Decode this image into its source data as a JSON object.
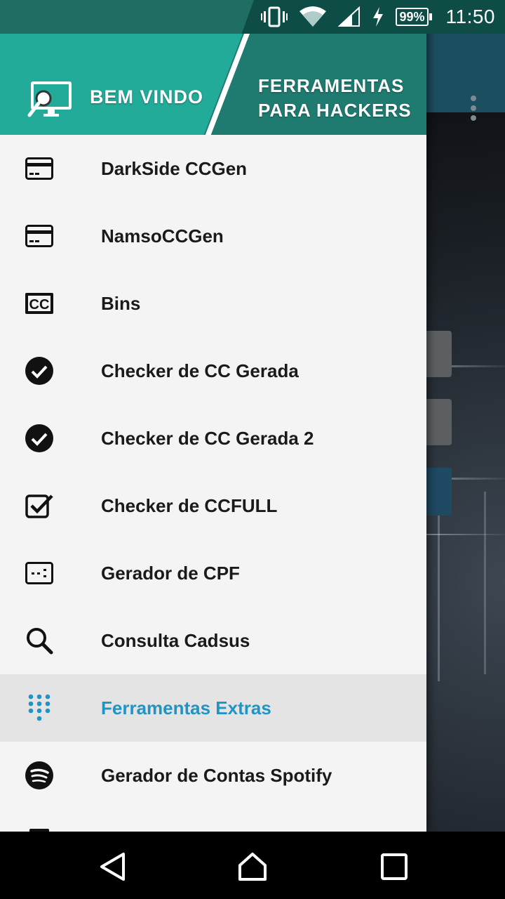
{
  "status_bar": {
    "battery": "99%",
    "time": "11:50",
    "icons": [
      "vibrate-icon",
      "wifi-icon",
      "signal-icon",
      "charging-icon",
      "battery-icon"
    ]
  },
  "drawer": {
    "header": {
      "welcome": "BEM VINDO",
      "brand_line1": "FERRAMENTAS",
      "brand_line2": "PARA HACKERS"
    },
    "items": [
      {
        "label": "DarkSide CCGen",
        "icon": "credit-card-icon"
      },
      {
        "label": "NamsoCCGen",
        "icon": "credit-card-icon"
      },
      {
        "label": "Bins",
        "icon": "cc-icon"
      },
      {
        "label": "Checker de CC Gerada",
        "icon": "check-circle-icon"
      },
      {
        "label": "Checker de CC Gerada 2",
        "icon": "check-circle-icon"
      },
      {
        "label": "Checker de CCFULL",
        "icon": "check-box-icon"
      },
      {
        "label": "Gerador de CPF",
        "icon": "dots-box-icon"
      },
      {
        "label": "Consulta Cadsus",
        "icon": "search-icon"
      },
      {
        "label": "Ferramentas Extras",
        "icon": "dialpad-icon",
        "active": true
      },
      {
        "label": "Gerador de Contas Spotify",
        "icon": "spotify-icon"
      }
    ],
    "active_color": "#2194c4"
  },
  "colors": {
    "header_dark": "#1f7a70",
    "header_light": "#22ab98",
    "status_bar": "#1e6e63",
    "drawer_bg": "#f4f4f4"
  },
  "nav_bar": {
    "buttons": [
      "back-icon",
      "home-icon",
      "recents-icon"
    ]
  }
}
